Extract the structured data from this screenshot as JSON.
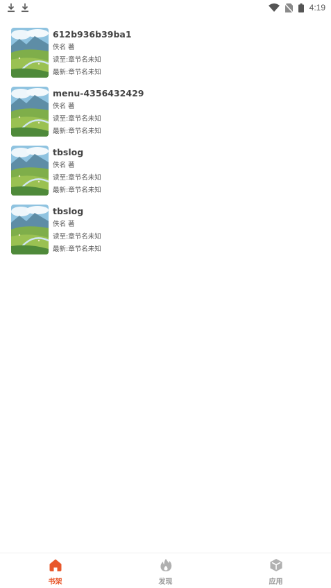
{
  "status_bar": {
    "time": "4:19",
    "left_icons": [
      "download-icon",
      "download-icon"
    ],
    "right_icons": [
      "wifi-icon",
      "no-sim-icon",
      "battery-icon"
    ]
  },
  "books": [
    {
      "title": "612b936b39ba1",
      "author": "佚名 著",
      "read_to": "读至:章节名未知",
      "latest": "最新:章节名未知"
    },
    {
      "title": "menu-4356432429",
      "author": "佚名 著",
      "read_to": "读至:章节名未知",
      "latest": "最新:章节名未知"
    },
    {
      "title": "tbslog",
      "author": "佚名 著",
      "read_to": "读至:章节名未知",
      "latest": "最新:章节名未知"
    },
    {
      "title": "tbslog",
      "author": "佚名 著",
      "read_to": "读至:章节名未知",
      "latest": "最新:章节名未知"
    }
  ],
  "bottom_nav": {
    "items": [
      {
        "label": "书架",
        "icon": "home-icon",
        "active": true
      },
      {
        "label": "发现",
        "icon": "flame-icon",
        "active": false
      },
      {
        "label": "应用",
        "icon": "cube-icon",
        "active": false
      }
    ]
  },
  "colors": {
    "accent": "#e8582c",
    "inactive": "#9a9a9a",
    "title_text": "#444444",
    "meta_text": "#555555"
  }
}
